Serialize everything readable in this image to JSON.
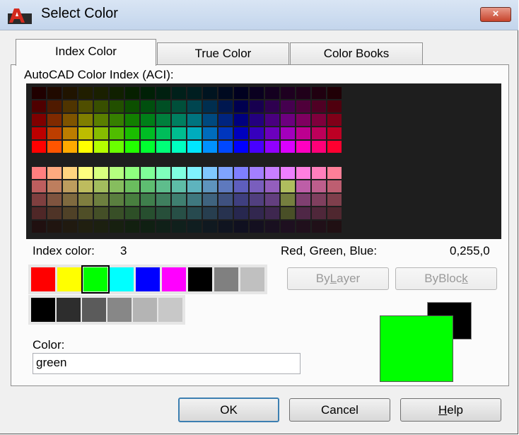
{
  "window": {
    "title": "Select Color",
    "close_symbol": "×",
    "app_icon": "autocad-logo-icon"
  },
  "tabs": [
    {
      "label": "Index Color",
      "active": true
    },
    {
      "label": "True Color",
      "active": false
    },
    {
      "label": "Color Books",
      "active": false
    }
  ],
  "aci": {
    "heading": "AutoCAD Color Index (ACI):",
    "top_palette": [
      [
        "#200000",
        "#200a00",
        "#201400",
        "#201e00",
        "#1a2000",
        "#102000",
        "#062000",
        "#002006",
        "#002010",
        "#00201a",
        "#001e20",
        "#001420",
        "#000a20",
        "#000020",
        "#0a0020",
        "#140020",
        "#1e0020",
        "#20001a",
        "#200010",
        "#200006"
      ],
      [
        "#4f0000",
        "#4f1a00",
        "#4f3400",
        "#4f4e00",
        "#384f00",
        "#224f00",
        "#0c4f00",
        "#004f0e",
        "#004f24",
        "#004f3a",
        "#00454f",
        "#002e4f",
        "#00174f",
        "#00004f",
        "#17004f",
        "#2e004f",
        "#45004f",
        "#4f003a",
        "#4f0024",
        "#4f000e"
      ],
      [
        "#7f0000",
        "#7f2a00",
        "#7f5400",
        "#7f7e00",
        "#5a7f00",
        "#367f00",
        "#127f00",
        "#007f18",
        "#007f3c",
        "#007f60",
        "#00747f",
        "#00497f",
        "#00247f",
        "#00007f",
        "#24007f",
        "#49007f",
        "#6d007f",
        "#7f0060",
        "#7f003c",
        "#7f0018"
      ],
      [
        "#bd0000",
        "#bd3e00",
        "#bd7d00",
        "#bdbc00",
        "#86bd00",
        "#50bd00",
        "#1abd00",
        "#00bd24",
        "#00bd5a",
        "#00bd90",
        "#00acbd",
        "#006cbd",
        "#0036bd",
        "#0000bd",
        "#3600bd",
        "#6c00bd",
        "#a300bd",
        "#bd0090",
        "#bd005a",
        "#bd0024"
      ],
      [
        "#ff0000",
        "#ff5500",
        "#ffaa00",
        "#ffff00",
        "#b4ff00",
        "#6aff00",
        "#22ff00",
        "#00ff30",
        "#00ff78",
        "#00ffc0",
        "#00e6ff",
        "#0091ff",
        "#0048ff",
        "#0000ff",
        "#4800ff",
        "#9100ff",
        "#da00ff",
        "#ff00c0",
        "#ff0078",
        "#ff0030"
      ]
    ],
    "bottom_palette": [
      [
        "#ff7f7f",
        "#ffaa7f",
        "#ffd47f",
        "#ffff7f",
        "#d9ff7f",
        "#b4ff7f",
        "#8fff7f",
        "#7fff98",
        "#7fffbc",
        "#7fffe0",
        "#7ff2ff",
        "#7fc8ff",
        "#7fa3ff",
        "#7f7fff",
        "#a37fff",
        "#c87fff",
        "#ed7fff",
        "#ff7fe0",
        "#ff7fbc",
        "#ff7f98"
      ],
      [
        "#bd5e5e",
        "#bd7e5e",
        "#bd9d5e",
        "#bdbc5e",
        "#a2bd5e",
        "#86bd5e",
        "#6abd5e",
        "#5ebd71",
        "#5ebd8c",
        "#5ebda7",
        "#5eb3bd",
        "#5e94bd",
        "#5e79bd",
        "#5e5ebd",
        "#795ebd",
        "#945ebd",
        "#afbd5e",
        "#bd5ea7",
        "#bd5e8c",
        "#bd5e71"
      ],
      [
        "#7f3f3f",
        "#7f543f",
        "#7f6a3f",
        "#7f7e3f",
        "#6d7f3f",
        "#5a7f3f",
        "#487f3f",
        "#3f7f4c",
        "#3f7f5e",
        "#3f7f70",
        "#3f787f",
        "#3f637f",
        "#3f517f",
        "#3f3f7f",
        "#513f7f",
        "#633f7f",
        "#757f3f",
        "#7f3f70",
        "#7f3f5e",
        "#7f3f4c"
      ],
      [
        "#4f2727",
        "#4f3427",
        "#4f4127",
        "#4f4e27",
        "#444f27",
        "#384f27",
        "#2d4f27",
        "#274f2f",
        "#274f3a",
        "#274f46",
        "#274a4f",
        "#273e4f",
        "#27324f",
        "#27274f",
        "#32274f",
        "#3e274f",
        "#494f27",
        "#4f2746",
        "#4f273a",
        "#4f272f"
      ],
      [
        "#201010",
        "#201510",
        "#201a10",
        "#201f10",
        "#1c2010",
        "#172010",
        "#122010",
        "#102013",
        "#102018",
        "#10201c",
        "#101e20",
        "#101920",
        "#101420",
        "#101020",
        "#141020",
        "#191020",
        "#1e1020",
        "#20101c",
        "#201018",
        "#201013"
      ]
    ]
  },
  "index_color": {
    "label": "Index color:",
    "value": "3"
  },
  "rgb": {
    "label": "Red, Green, Blue:",
    "value": "0,255,0"
  },
  "standard_colors": [
    "#ff0000",
    "#ffff00",
    "#00ff00",
    "#00ffff",
    "#0000ff",
    "#ff00ff",
    "#000000",
    "#808080",
    "#c0c0c0"
  ],
  "selected_standard_index": 2,
  "gray_colors": [
    "#000000",
    "#2d2d2d",
    "#5b5b5b",
    "#878787",
    "#b4b4b4",
    "#c8c8c8"
  ],
  "bylayer": {
    "pre": "By",
    "key": "L",
    "post": "ayer"
  },
  "byblock": {
    "pre": "ByBloc",
    "key": "k",
    "post": ""
  },
  "color_field": {
    "label": "Color:",
    "value": "green"
  },
  "preview": {
    "previous_color": "#000000",
    "new_color": "#00ff00"
  },
  "buttons": {
    "ok": "OK",
    "cancel": "Cancel",
    "help": {
      "key": "H",
      "post": "elp"
    }
  }
}
